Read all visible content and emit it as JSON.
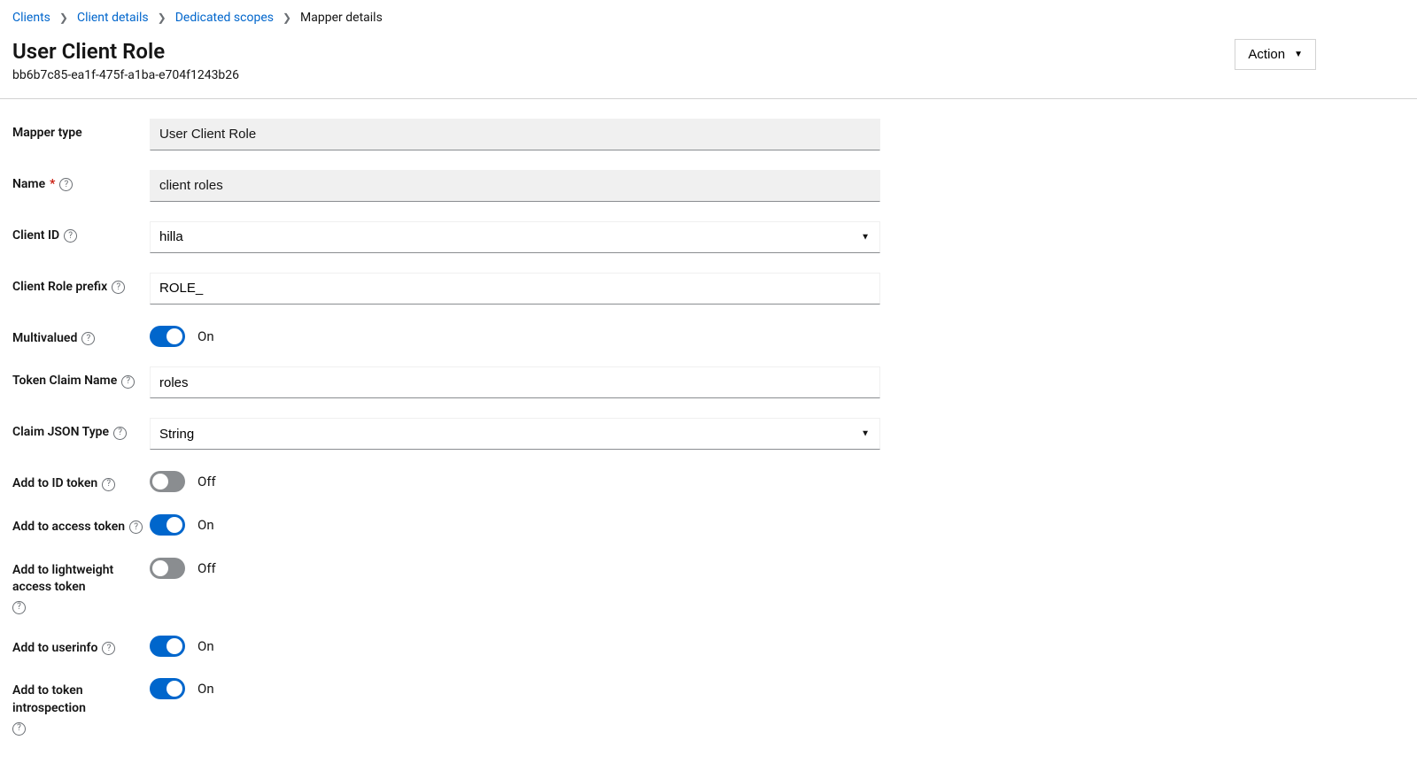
{
  "breadcrumb": {
    "items": [
      {
        "label": "Clients",
        "link": true
      },
      {
        "label": "Client details",
        "link": true
      },
      {
        "label": "Dedicated scopes",
        "link": true
      },
      {
        "label": "Mapper details",
        "link": false
      }
    ]
  },
  "header": {
    "title": "User Client Role",
    "uuid": "bb6b7c85-ea1f-475f-a1ba-e704f1243b26",
    "action_label": "Action"
  },
  "labels": {
    "mapper_type": "Mapper type",
    "name": "Name",
    "client_id": "Client ID",
    "client_role_prefix": "Client Role prefix",
    "multivalued": "Multivalued",
    "token_claim_name": "Token Claim Name",
    "claim_json_type": "Claim JSON Type",
    "add_id_token": "Add to ID token",
    "add_access_token": "Add to access token",
    "add_lightweight": "Add to lightweight access token",
    "add_userinfo": "Add to userinfo",
    "add_introspection": "Add to token introspection"
  },
  "values": {
    "mapper_type": "User Client Role",
    "name": "client roles",
    "client_id": "hilla",
    "client_role_prefix": "ROLE_",
    "token_claim_name": "roles",
    "claim_json_type": "String"
  },
  "toggles": {
    "on_label": "On",
    "off_label": "Off",
    "multivalued": true,
    "add_id_token": false,
    "add_access_token": true,
    "add_lightweight": false,
    "add_userinfo": true,
    "add_introspection": true
  }
}
